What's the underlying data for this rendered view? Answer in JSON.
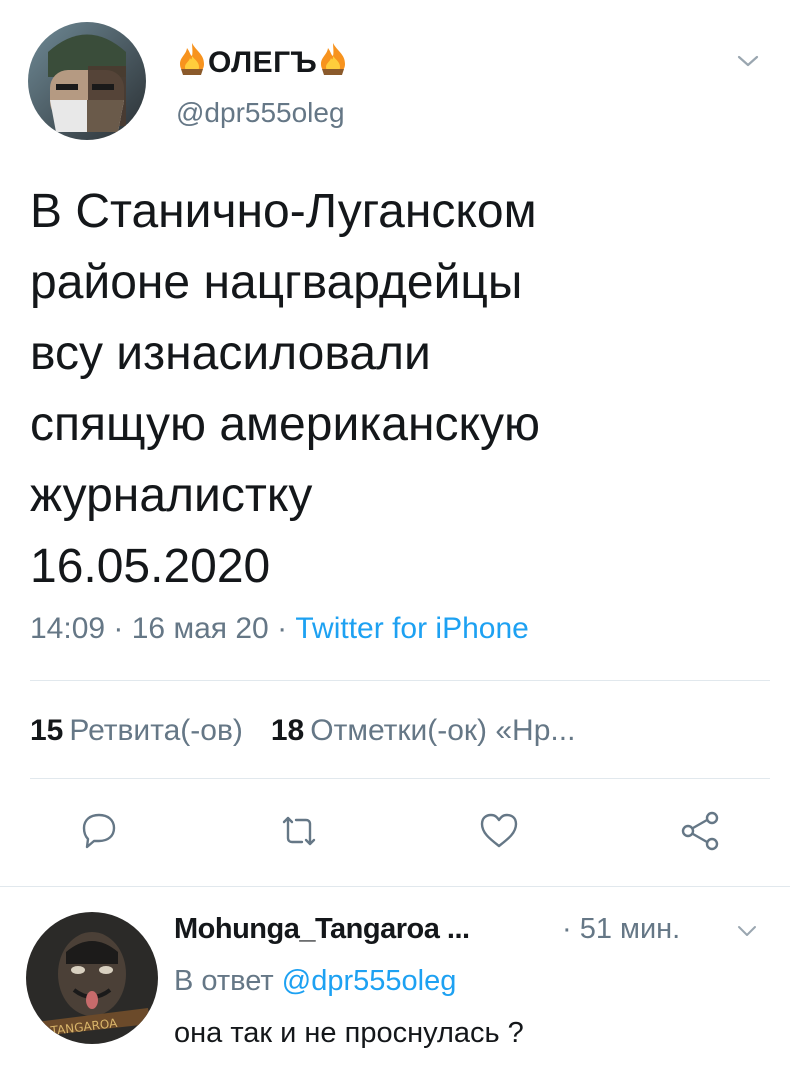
{
  "tweet": {
    "author": {
      "name_prefix_icon": "fire-icon",
      "name": "ОЛЕГЪ",
      "name_suffix_icon": "fire-icon",
      "handle": "@dpr555oleg",
      "avatar_icon": "avatar-photo"
    },
    "text": "В Станично-Луганском\nрайоне нацгвардейцы\nвсу изнасиловали\nспящую американскую\nжурналистку\n16.05.2020",
    "time": "14:09",
    "date": "16 мая 20",
    "client": "Twitter for iPhone",
    "retweets": {
      "count": "15",
      "label": "Ретвита(-ов)"
    },
    "likes": {
      "count": "18",
      "label": "Отметки(-ок) «Нр..."
    },
    "actions": [
      {
        "icon": "reply-icon"
      },
      {
        "icon": "retweet-icon"
      },
      {
        "icon": "like-heart-icon"
      },
      {
        "icon": "share-icon"
      }
    ]
  },
  "reply": {
    "author_name": "Mohunga_Tangaroa ...",
    "time": "· 51 мин.",
    "reply_to_label": "В ответ",
    "reply_to_handle": "@dpr555oleg",
    "text": "она так и не проснулась ?"
  },
  "colors": {
    "text": "#14171a",
    "secondary": "#657786",
    "accent": "#1da1f2",
    "divider": "#e1e8ed"
  }
}
